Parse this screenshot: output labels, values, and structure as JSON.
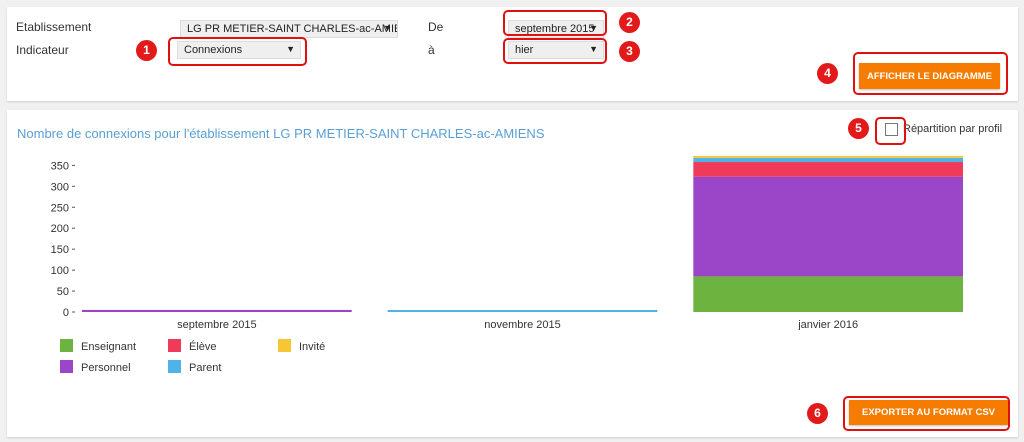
{
  "filters": {
    "etablissement_label": "Etablissement",
    "etablissement_value": "LG PR METIER-SAINT CHARLES-ac-AMIENS",
    "indicateur_label": "Indicateur",
    "indicateur_value": "Connexions",
    "de_label": "De",
    "de_value": "septembre 2015",
    "a_label": "à",
    "a_value": "hier",
    "show_button": "AFFICHER LE DIAGRAMME"
  },
  "markers": [
    "1",
    "2",
    "3",
    "4",
    "5",
    "6"
  ],
  "results": {
    "title": "Nombre de connexions pour l'établissement LG PR METIER-SAINT CHARLES-ac-AMIENS",
    "repartition_label": "Répartition par profil",
    "export_button": "EXPORTER AU FORMAT CSV"
  },
  "colors": {
    "accent": "#f57c00",
    "highlight": "#e01010",
    "title": "#5a9fd4"
  },
  "chart_data": {
    "type": "bar",
    "stacked": true,
    "categories": [
      "septembre 2015",
      "novembre 2015",
      "janvier 2016"
    ],
    "yticks": [
      0,
      50,
      100,
      150,
      200,
      250,
      300,
      350
    ],
    "ylim": [
      0,
      370
    ],
    "series": [
      {
        "name": "Enseignant",
        "color": "#6db33f",
        "values": [
          0,
          0,
          85
        ]
      },
      {
        "name": "Personnel",
        "color": "#9b45c8",
        "values": [
          5,
          0,
          238
        ]
      },
      {
        "name": "Élève",
        "color": "#f03a5a",
        "values": [
          0,
          0,
          35
        ]
      },
      {
        "name": "Parent",
        "color": "#4fb3e8",
        "values": [
          0,
          1,
          10
        ]
      },
      {
        "name": "Invité",
        "color": "#f7c636",
        "values": [
          0,
          0,
          2
        ]
      }
    ],
    "legend": [
      "Enseignant",
      "Élève",
      "Invité",
      "Personnel",
      "Parent"
    ]
  }
}
